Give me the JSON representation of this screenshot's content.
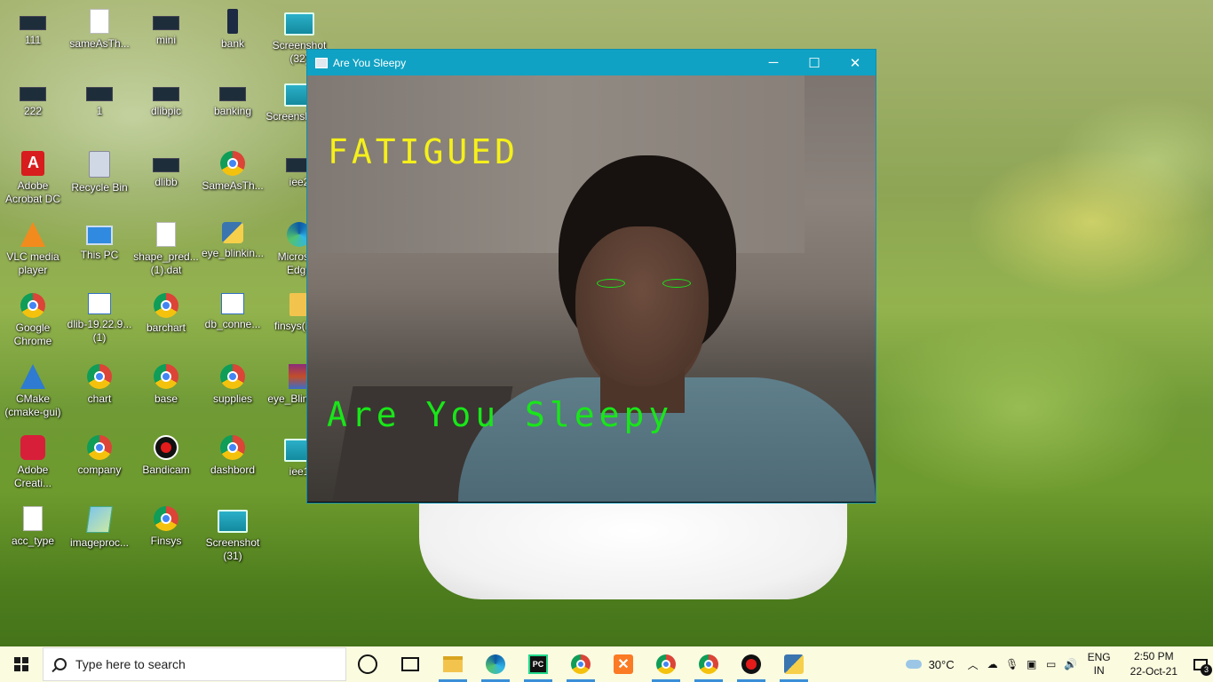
{
  "desktop": {
    "icons": [
      {
        "label": "111",
        "icon": "window-thumb-icon"
      },
      {
        "label": "sameAsTh...",
        "icon": "text-file-icon"
      },
      {
        "label": "mini",
        "icon": "image-thumb-icon"
      },
      {
        "label": "bank",
        "icon": "phone-thumb-icon"
      },
      {
        "label": "Screenshot (32)",
        "icon": "screenshot-icon"
      },
      {
        "label": "222",
        "icon": "window-thumb-icon"
      },
      {
        "label": "1",
        "icon": "window-thumb-icon"
      },
      {
        "label": "dlibpic",
        "icon": "window-thumb-icon"
      },
      {
        "label": "banking",
        "icon": "window-thumb-icon"
      },
      {
        "label": "Screensh (33)",
        "icon": "screenshot-icon"
      },
      {
        "label": "Adobe Acrobat DC",
        "icon": "acrobat-icon"
      },
      {
        "label": "Recycle Bin",
        "icon": "recycle-bin-icon"
      },
      {
        "label": "dlibb",
        "icon": "window-thumb-icon"
      },
      {
        "label": "SameAsTh...",
        "icon": "chrome-icon"
      },
      {
        "label": "iee2",
        "icon": "image-thumb-icon"
      },
      {
        "label": "VLC media player",
        "icon": "vlc-icon"
      },
      {
        "label": "This PC",
        "icon": "this-pc-icon"
      },
      {
        "label": "shape_pred... (1).dat",
        "icon": "file-icon"
      },
      {
        "label": "eye_blinkin...",
        "icon": "python-file-icon"
      },
      {
        "label": "Microsoft Edge",
        "icon": "edge-icon"
      },
      {
        "label": "Google Chrome",
        "icon": "chrome-icon"
      },
      {
        "label": "dlib-19.22.9... (1)",
        "icon": "document-icon"
      },
      {
        "label": "barchart",
        "icon": "chrome-icon"
      },
      {
        "label": "db_conne...",
        "icon": "document-icon"
      },
      {
        "label": "finsys(RD)",
        "icon": "folder-icon"
      },
      {
        "label": "CMake (cmake-gui)",
        "icon": "cmake-icon"
      },
      {
        "label": "chart",
        "icon": "chrome-icon"
      },
      {
        "label": "base",
        "icon": "chrome-icon"
      },
      {
        "label": "supplies",
        "icon": "chrome-icon"
      },
      {
        "label": "eye_Blinkin...",
        "icon": "winrar-icon"
      },
      {
        "label": "Adobe Creati...",
        "icon": "creative-cloud-icon"
      },
      {
        "label": "company",
        "icon": "chrome-icon"
      },
      {
        "label": "Bandicam",
        "icon": "bandicam-icon"
      },
      {
        "label": "dashbord",
        "icon": "chrome-icon"
      },
      {
        "label": "iee1",
        "icon": "screenshot-icon"
      },
      {
        "label": "acc_type",
        "icon": "text-file-icon"
      },
      {
        "label": "imageproc...",
        "icon": "image-file-icon"
      },
      {
        "label": "Finsys",
        "icon": "chrome-icon"
      },
      {
        "label": "Screenshot (31)",
        "icon": "screenshot-icon"
      }
    ]
  },
  "window": {
    "title": "Are You Sleepy",
    "controls": {
      "minimize": "─",
      "maximize": "☐",
      "close": "✕"
    },
    "overlay_status": "FATIGUED",
    "overlay_caption": "Are You Sleepy",
    "status_color": "#f5f01a",
    "caption_color": "#19e619"
  },
  "taskbar": {
    "search_placeholder": "Type here to search",
    "pinned": [
      {
        "icon": "cortana-icon"
      },
      {
        "icon": "task-view-icon"
      },
      {
        "icon": "file-explorer-icon"
      },
      {
        "icon": "edge-icon"
      },
      {
        "icon": "pycharm-icon"
      },
      {
        "icon": "chrome-profile-icon"
      },
      {
        "icon": "xampp-icon"
      },
      {
        "icon": "chrome-profile-icon"
      },
      {
        "icon": "chrome-icon"
      },
      {
        "icon": "bandicam-icon"
      },
      {
        "icon": "python-app-icon"
      }
    ],
    "tray": {
      "temperature": "30°C",
      "language_line1": "ENG",
      "language_line2": "IN",
      "time": "2:50 PM",
      "date": "22-Oct-21",
      "notification_count": "3"
    }
  }
}
